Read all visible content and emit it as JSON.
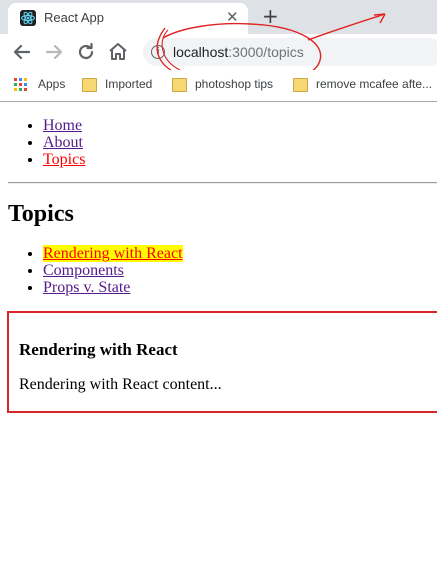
{
  "tab": {
    "title": "React App",
    "close_glyph": "✕",
    "newtab_glyph": "+"
  },
  "toolbar": {
    "back_icon": "arrow-left-icon",
    "forward_icon": "arrow-right-icon",
    "reload_icon": "reload-icon",
    "home_icon": "home-icon",
    "url_host": "localhost",
    "url_path": ":3000/topics"
  },
  "bookmarks": [
    {
      "label": "Apps",
      "icon": "apps-grid-icon"
    },
    {
      "label": "Imported",
      "icon": "folder-icon"
    },
    {
      "label": "photoshop tips",
      "icon": "folder-icon"
    },
    {
      "label": "remove mcafee afte...",
      "icon": "folder-icon"
    }
  ],
  "nav": {
    "items": [
      {
        "label": "Home"
      },
      {
        "label": "About"
      },
      {
        "label": "Topics",
        "active": true
      }
    ]
  },
  "topics": {
    "heading": "Topics",
    "items": [
      {
        "label": "Rendering with React",
        "active": true
      },
      {
        "label": "Components"
      },
      {
        "label": "Props v. State"
      }
    ],
    "detail_heading": "Rendering with React",
    "detail_text": "Rendering with React content..."
  },
  "colors": {
    "active_link": "#ff0000",
    "visited_link": "#551a8b",
    "highlight": "#ffff00",
    "box_border": "#d62626",
    "annotation": "#e02424"
  }
}
